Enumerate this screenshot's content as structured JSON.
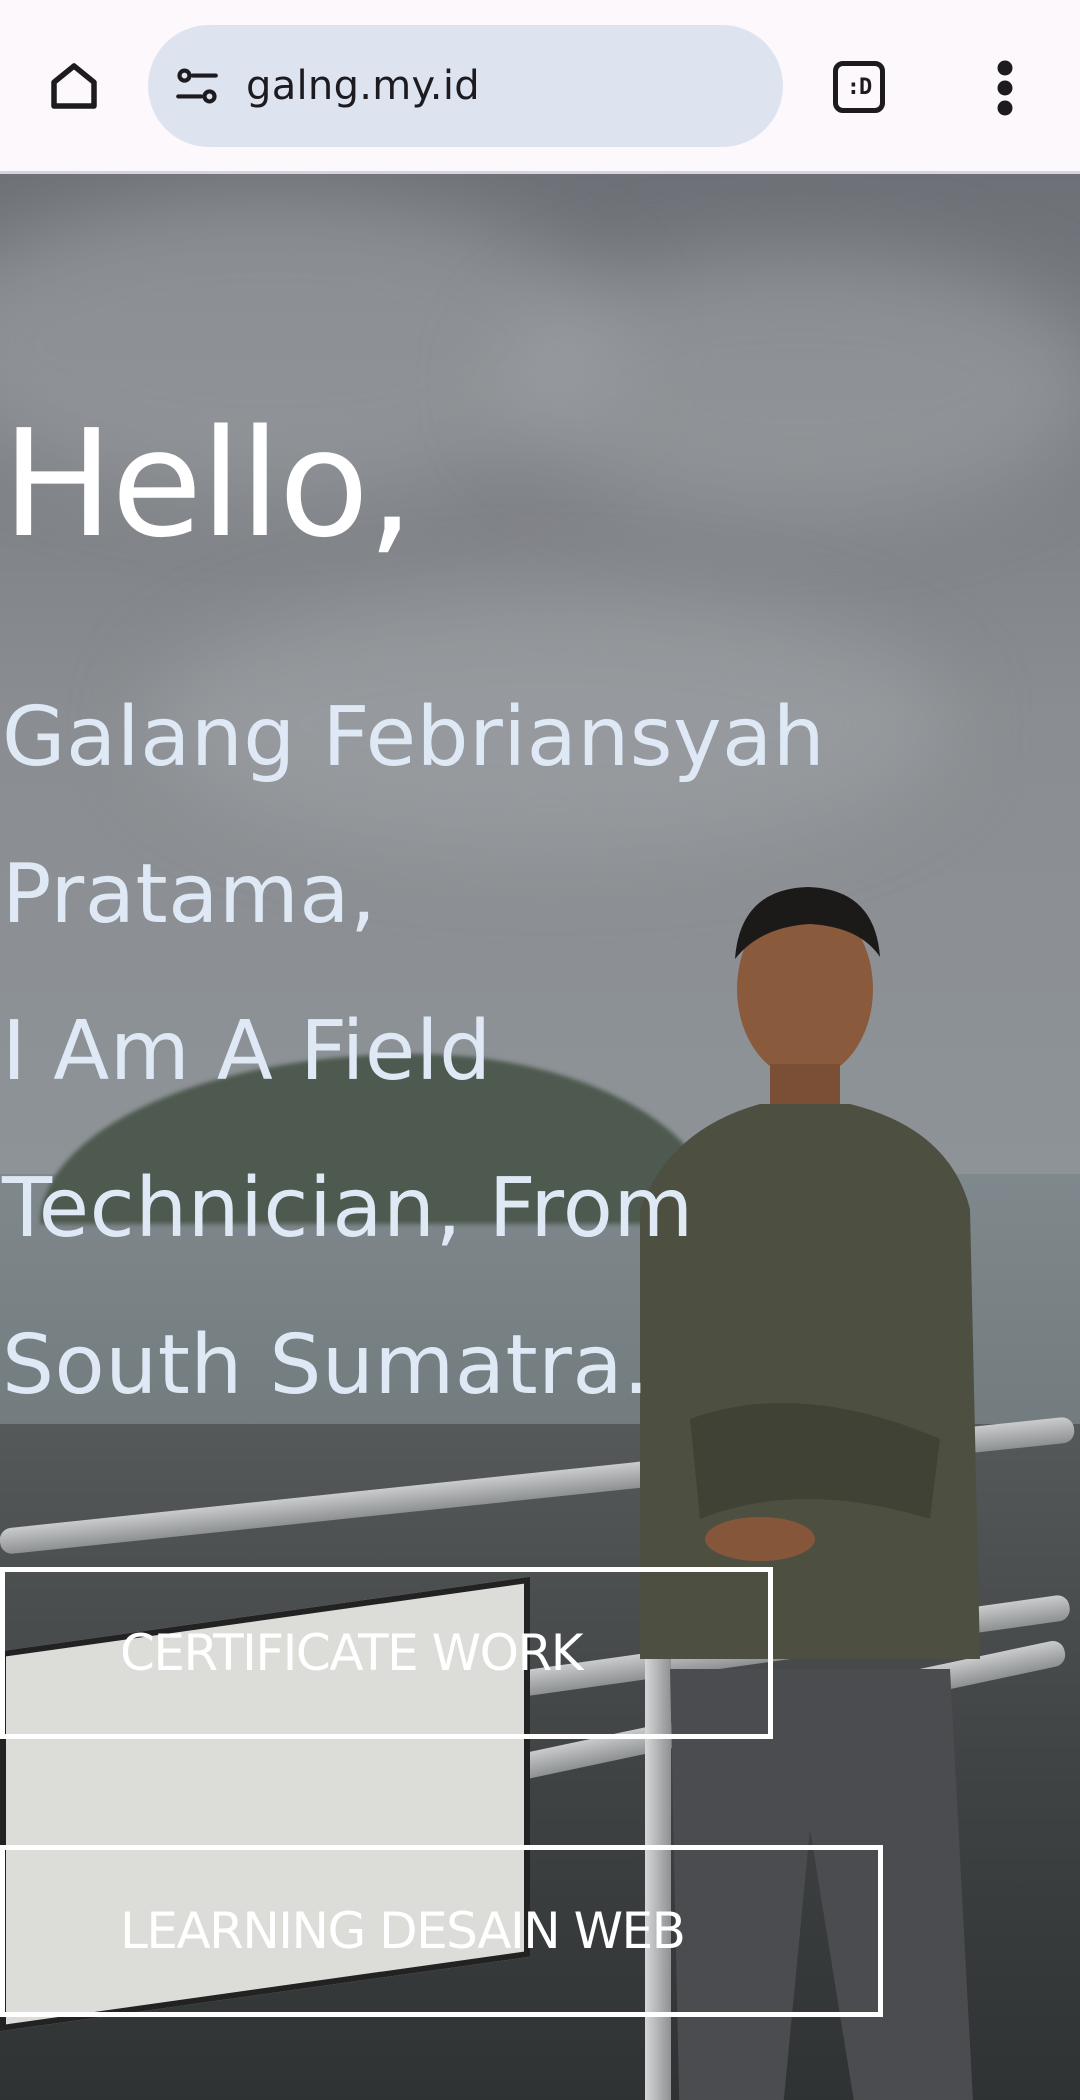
{
  "browser": {
    "url": "galng.my.id",
    "tab_icon_text": ":D",
    "icons": {
      "home": "home-icon",
      "site_settings": "tune-icon",
      "tabs": "tab-switcher-icon",
      "menu": "more-vert-icon"
    }
  },
  "hero": {
    "greeting": "Hello,",
    "intro_lines": [
      "Galang Febriansyah",
      "Pratama,",
      "I Am A Field",
      "Technician, From",
      "South Sumatra."
    ],
    "buttons": {
      "certificate": "CERTIFICATE WORK",
      "learning": "LEARNING DESAIN WEB"
    }
  },
  "colors": {
    "greeting": "#ffffff",
    "intro_text": "#dfe9f5",
    "url_pill": "#dde4f0",
    "button_border": "#ffffff"
  }
}
